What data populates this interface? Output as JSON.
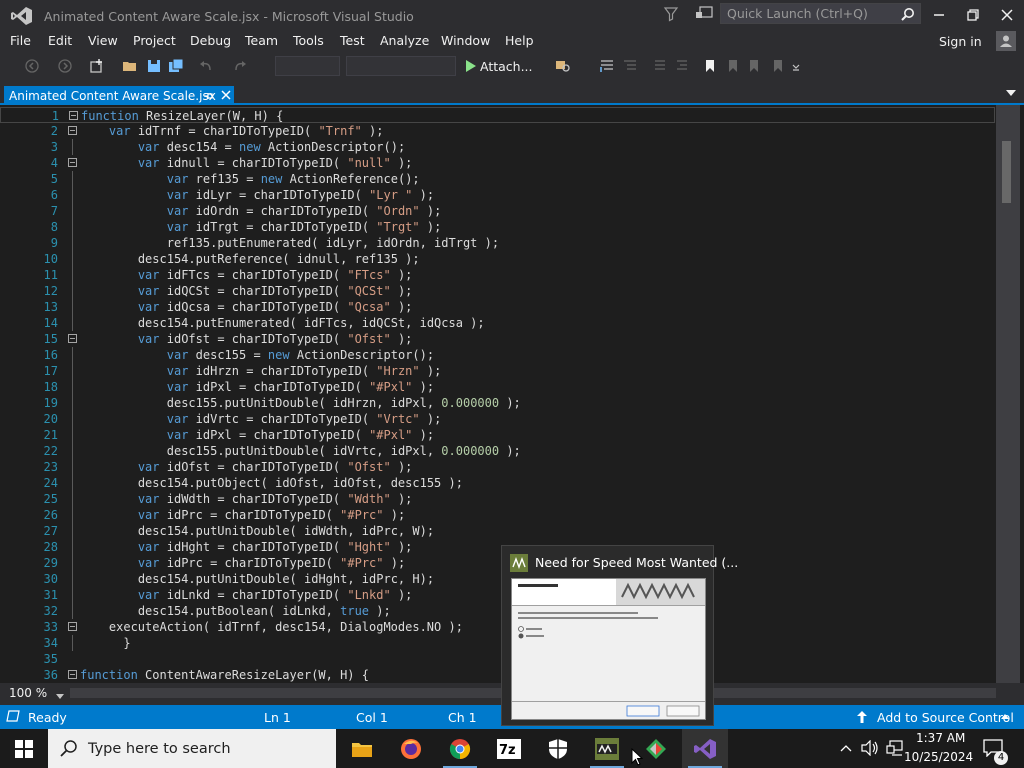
{
  "window": {
    "title": "Animated Content Aware Scale.jsx - Microsoft Visual Studio",
    "quick_launch_placeholder": "Quick Launch (Ctrl+Q)"
  },
  "menu": {
    "items": [
      "File",
      "Edit",
      "View",
      "Project",
      "Debug",
      "Team",
      "Tools",
      "Test",
      "Analyze",
      "Window",
      "Help"
    ],
    "sign_in": "Sign in"
  },
  "toolbar": {
    "attach_label": "Attach..."
  },
  "tab": {
    "label": "Animated Content Aware Scale.jsx"
  },
  "editor": {
    "zoom": "100 %",
    "lines": [
      {
        "n": "1",
        "fold": true,
        "indent": 0,
        "text": "function ResizeLayer(W, H) {"
      },
      {
        "n": "2",
        "fold": true,
        "indent": 1,
        "text": "var idTrnf = charIDToTypeID( \"Trnf\" );"
      },
      {
        "n": "3",
        "indent": 2,
        "text": "var desc154 = new ActionDescriptor();"
      },
      {
        "n": "4",
        "fold": true,
        "indent": 2,
        "text": "var idnull = charIDToTypeID( \"null\" );"
      },
      {
        "n": "5",
        "indent": 3,
        "text": "var ref135 = new ActionReference();"
      },
      {
        "n": "6",
        "indent": 3,
        "text": "var idLyr = charIDToTypeID( \"Lyr \" );"
      },
      {
        "n": "7",
        "indent": 3,
        "text": "var idOrdn = charIDToTypeID( \"Ordn\" );"
      },
      {
        "n": "8",
        "indent": 3,
        "text": "var idTrgt = charIDToTypeID( \"Trgt\" );"
      },
      {
        "n": "9",
        "indent": 3,
        "text": "ref135.putEnumerated( idLyr, idOrdn, idTrgt );"
      },
      {
        "n": "10",
        "indent": 2,
        "text": "desc154.putReference( idnull, ref135 );"
      },
      {
        "n": "11",
        "indent": 2,
        "text": "var idFTcs = charIDToTypeID( \"FTcs\" );"
      },
      {
        "n": "12",
        "indent": 2,
        "text": "var idQCSt = charIDToTypeID( \"QCSt\" );"
      },
      {
        "n": "13",
        "indent": 2,
        "text": "var idQcsa = charIDToTypeID( \"Qcsa\" );"
      },
      {
        "n": "14",
        "indent": 2,
        "text": "desc154.putEnumerated( idFTcs, idQCSt, idQcsa );"
      },
      {
        "n": "15",
        "fold": true,
        "indent": 2,
        "text": "var idOfst = charIDToTypeID( \"Ofst\" );"
      },
      {
        "n": "16",
        "indent": 3,
        "text": "var desc155 = new ActionDescriptor();"
      },
      {
        "n": "17",
        "indent": 3,
        "text": "var idHrzn = charIDToTypeID( \"Hrzn\" );"
      },
      {
        "n": "18",
        "indent": 3,
        "text": "var idPxl = charIDToTypeID( \"#Pxl\" );"
      },
      {
        "n": "19",
        "indent": 3,
        "text": "desc155.putUnitDouble( idHrzn, idPxl, 0.000000 );"
      },
      {
        "n": "20",
        "indent": 3,
        "text": "var idVrtc = charIDToTypeID( \"Vrtc\" );"
      },
      {
        "n": "21",
        "indent": 3,
        "text": "var idPxl = charIDToTypeID( \"#Pxl\" );"
      },
      {
        "n": "22",
        "indent": 3,
        "text": "desc155.putUnitDouble( idVrtc, idPxl, 0.000000 );"
      },
      {
        "n": "23",
        "indent": 2,
        "text": "var idOfst = charIDToTypeID( \"Ofst\" );"
      },
      {
        "n": "24",
        "indent": 2,
        "text": "desc154.putObject( idOfst, idOfst, desc155 );"
      },
      {
        "n": "25",
        "indent": 2,
        "text": "var idWdth = charIDToTypeID( \"Wdth\" );"
      },
      {
        "n": "26",
        "indent": 2,
        "text": "var idPrc = charIDToTypeID( \"#Prc\" );"
      },
      {
        "n": "27",
        "indent": 2,
        "text": "desc154.putUnitDouble( idWdth, idPrc, W);"
      },
      {
        "n": "28",
        "indent": 2,
        "text": "var idHght = charIDToTypeID( \"Hght\" );"
      },
      {
        "n": "29",
        "indent": 2,
        "text": "var idPrc = charIDToTypeID( \"#Prc\" );"
      },
      {
        "n": "30",
        "indent": 2,
        "text": "desc154.putUnitDouble( idHght, idPrc, H);"
      },
      {
        "n": "31",
        "indent": 2,
        "text": "var idLnkd = charIDToTypeID( \"Lnkd\" );"
      },
      {
        "n": "32",
        "indent": 2,
        "text": "desc154.putBoolean( idLnkd, true );"
      },
      {
        "n": "33",
        "fold": true,
        "indent": 1,
        "text": "executeAction( idTrnf, desc154, DialogModes.NO );"
      },
      {
        "n": "34",
        "indent": 1,
        "text": "  }"
      },
      {
        "n": "35",
        "indent": 0,
        "text": ""
      },
      {
        "n": "36",
        "fold": true,
        "indent": 0,
        "text": "function ContentAwareResizeLayer(W, H) {"
      }
    ]
  },
  "status": {
    "ready": "Ready",
    "ln": "Ln 1",
    "col": "Col 1",
    "ch": "Ch 1",
    "source_control": "Add to Source Control"
  },
  "taskbar": {
    "search_placeholder": "Type here to search",
    "time": "1:37 AM",
    "date": "10/25/2024",
    "notification_count": "4",
    "preview_title": "Need for Speed Most Wanted (..."
  }
}
